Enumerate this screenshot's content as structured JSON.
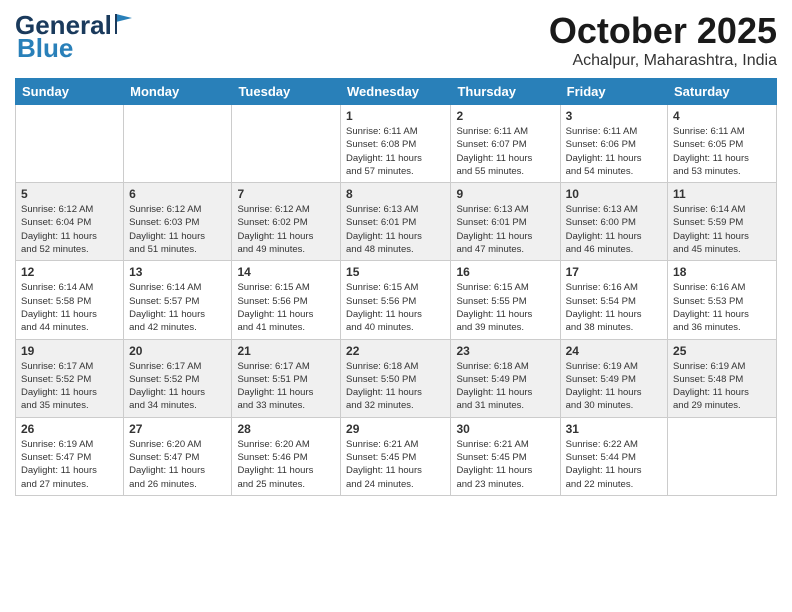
{
  "header": {
    "logo_general": "General",
    "logo_blue": "Blue",
    "month": "October 2025",
    "location": "Achalpur, Maharashtra, India"
  },
  "days_of_week": [
    "Sunday",
    "Monday",
    "Tuesday",
    "Wednesday",
    "Thursday",
    "Friday",
    "Saturday"
  ],
  "weeks": [
    [
      {
        "day": "",
        "info": ""
      },
      {
        "day": "",
        "info": ""
      },
      {
        "day": "",
        "info": ""
      },
      {
        "day": "1",
        "info": "Sunrise: 6:11 AM\nSunset: 6:08 PM\nDaylight: 11 hours\nand 57 minutes."
      },
      {
        "day": "2",
        "info": "Sunrise: 6:11 AM\nSunset: 6:07 PM\nDaylight: 11 hours\nand 55 minutes."
      },
      {
        "day": "3",
        "info": "Sunrise: 6:11 AM\nSunset: 6:06 PM\nDaylight: 11 hours\nand 54 minutes."
      },
      {
        "day": "4",
        "info": "Sunrise: 6:11 AM\nSunset: 6:05 PM\nDaylight: 11 hours\nand 53 minutes."
      }
    ],
    [
      {
        "day": "5",
        "info": "Sunrise: 6:12 AM\nSunset: 6:04 PM\nDaylight: 11 hours\nand 52 minutes."
      },
      {
        "day": "6",
        "info": "Sunrise: 6:12 AM\nSunset: 6:03 PM\nDaylight: 11 hours\nand 51 minutes."
      },
      {
        "day": "7",
        "info": "Sunrise: 6:12 AM\nSunset: 6:02 PM\nDaylight: 11 hours\nand 49 minutes."
      },
      {
        "day": "8",
        "info": "Sunrise: 6:13 AM\nSunset: 6:01 PM\nDaylight: 11 hours\nand 48 minutes."
      },
      {
        "day": "9",
        "info": "Sunrise: 6:13 AM\nSunset: 6:01 PM\nDaylight: 11 hours\nand 47 minutes."
      },
      {
        "day": "10",
        "info": "Sunrise: 6:13 AM\nSunset: 6:00 PM\nDaylight: 11 hours\nand 46 minutes."
      },
      {
        "day": "11",
        "info": "Sunrise: 6:14 AM\nSunset: 5:59 PM\nDaylight: 11 hours\nand 45 minutes."
      }
    ],
    [
      {
        "day": "12",
        "info": "Sunrise: 6:14 AM\nSunset: 5:58 PM\nDaylight: 11 hours\nand 44 minutes."
      },
      {
        "day": "13",
        "info": "Sunrise: 6:14 AM\nSunset: 5:57 PM\nDaylight: 11 hours\nand 42 minutes."
      },
      {
        "day": "14",
        "info": "Sunrise: 6:15 AM\nSunset: 5:56 PM\nDaylight: 11 hours\nand 41 minutes."
      },
      {
        "day": "15",
        "info": "Sunrise: 6:15 AM\nSunset: 5:56 PM\nDaylight: 11 hours\nand 40 minutes."
      },
      {
        "day": "16",
        "info": "Sunrise: 6:15 AM\nSunset: 5:55 PM\nDaylight: 11 hours\nand 39 minutes."
      },
      {
        "day": "17",
        "info": "Sunrise: 6:16 AM\nSunset: 5:54 PM\nDaylight: 11 hours\nand 38 minutes."
      },
      {
        "day": "18",
        "info": "Sunrise: 6:16 AM\nSunset: 5:53 PM\nDaylight: 11 hours\nand 36 minutes."
      }
    ],
    [
      {
        "day": "19",
        "info": "Sunrise: 6:17 AM\nSunset: 5:52 PM\nDaylight: 11 hours\nand 35 minutes."
      },
      {
        "day": "20",
        "info": "Sunrise: 6:17 AM\nSunset: 5:52 PM\nDaylight: 11 hours\nand 34 minutes."
      },
      {
        "day": "21",
        "info": "Sunrise: 6:17 AM\nSunset: 5:51 PM\nDaylight: 11 hours\nand 33 minutes."
      },
      {
        "day": "22",
        "info": "Sunrise: 6:18 AM\nSunset: 5:50 PM\nDaylight: 11 hours\nand 32 minutes."
      },
      {
        "day": "23",
        "info": "Sunrise: 6:18 AM\nSunset: 5:49 PM\nDaylight: 11 hours\nand 31 minutes."
      },
      {
        "day": "24",
        "info": "Sunrise: 6:19 AM\nSunset: 5:49 PM\nDaylight: 11 hours\nand 30 minutes."
      },
      {
        "day": "25",
        "info": "Sunrise: 6:19 AM\nSunset: 5:48 PM\nDaylight: 11 hours\nand 29 minutes."
      }
    ],
    [
      {
        "day": "26",
        "info": "Sunrise: 6:19 AM\nSunset: 5:47 PM\nDaylight: 11 hours\nand 27 minutes."
      },
      {
        "day": "27",
        "info": "Sunrise: 6:20 AM\nSunset: 5:47 PM\nDaylight: 11 hours\nand 26 minutes."
      },
      {
        "day": "28",
        "info": "Sunrise: 6:20 AM\nSunset: 5:46 PM\nDaylight: 11 hours\nand 25 minutes."
      },
      {
        "day": "29",
        "info": "Sunrise: 6:21 AM\nSunset: 5:45 PM\nDaylight: 11 hours\nand 24 minutes."
      },
      {
        "day": "30",
        "info": "Sunrise: 6:21 AM\nSunset: 5:45 PM\nDaylight: 11 hours\nand 23 minutes."
      },
      {
        "day": "31",
        "info": "Sunrise: 6:22 AM\nSunset: 5:44 PM\nDaylight: 11 hours\nand 22 minutes."
      },
      {
        "day": "",
        "info": ""
      }
    ]
  ]
}
